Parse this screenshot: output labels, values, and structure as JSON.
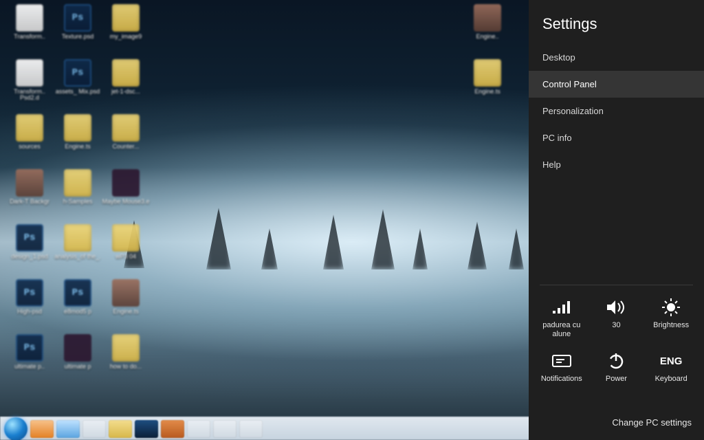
{
  "desktop": {
    "icons_left": [
      {
        "label": "Transform..",
        "kind": "paper"
      },
      {
        "label": "Texture.psd",
        "kind": "ps"
      },
      {
        "label": "my_image9",
        "kind": "folder"
      },
      {
        "label": "Transform.. Psd2.d",
        "kind": "paper"
      },
      {
        "label": "assets_ Mix.psd",
        "kind": "ps"
      },
      {
        "label": "jet-1-dsc...",
        "kind": "folder"
      },
      {
        "label": "sources",
        "kind": "folder"
      },
      {
        "label": "Engine.ts",
        "kind": "folder"
      },
      {
        "label": "Counter...",
        "kind": "folder"
      },
      {
        "label": "Dark-T Backgr",
        "kind": "port"
      },
      {
        "label": "h-Samples",
        "kind": "folder"
      },
      {
        "label": "Maybe Mouse3.e",
        "kind": "dark"
      },
      {
        "label": "design_1.psd",
        "kind": "ps"
      },
      {
        "label": "analysis_of the_.",
        "kind": "folder"
      },
      {
        "label": "wP3 04",
        "kind": "folder"
      },
      {
        "label": "High-psd",
        "kind": "ps"
      },
      {
        "label": "e8mod5 p",
        "kind": "ps"
      },
      {
        "label": "Engine.ts",
        "kind": "port"
      },
      {
        "label": "ultimate p..",
        "kind": "ps"
      },
      {
        "label": "ultimate p",
        "kind": "dark"
      },
      {
        "label": "how to do...",
        "kind": "folder"
      }
    ],
    "icons_right": [
      {
        "label": "Engine..",
        "kind": "port"
      },
      {
        "label": "Engine.ts",
        "kind": "folder"
      }
    ],
    "taskbar": [
      "orb",
      "firefox",
      "explorer",
      "chrome",
      "folder",
      "ps",
      "app",
      "app",
      "app",
      "app"
    ]
  },
  "pane": {
    "title": "Settings",
    "items": [
      {
        "label": "Desktop",
        "active": false
      },
      {
        "label": "Control Panel",
        "active": true
      },
      {
        "label": "Personalization",
        "active": false
      },
      {
        "label": "PC info",
        "active": false
      },
      {
        "label": "Help",
        "active": false
      }
    ],
    "quick": [
      {
        "key": "network",
        "label": "padurea cu alune"
      },
      {
        "key": "volume",
        "label": "30"
      },
      {
        "key": "brightness",
        "label": "Brightness"
      },
      {
        "key": "notifications",
        "label": "Notifications"
      },
      {
        "key": "power",
        "label": "Power"
      },
      {
        "key": "keyboard",
        "label": "Keyboard",
        "badge": "ENG"
      }
    ],
    "change": "Change PC settings"
  }
}
